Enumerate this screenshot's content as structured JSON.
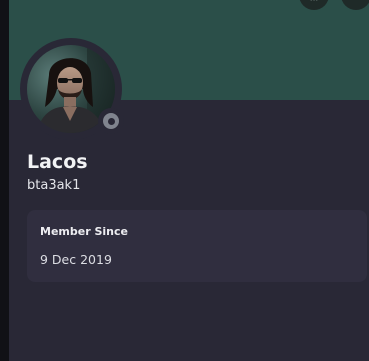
{
  "profile": {
    "display_name": "Lacos",
    "username": "bta3ak1",
    "status": "offline",
    "banner_color": "#2b4f49",
    "avatar_description": "photo of a man with long dark hair and beard"
  },
  "banner_buttons": [
    {
      "icon": "badge-icon",
      "label": "..."
    },
    {
      "icon": "more-icon",
      "label": ""
    }
  ],
  "member_since": {
    "title": "Member Since",
    "date": "9 Dec 2019"
  }
}
